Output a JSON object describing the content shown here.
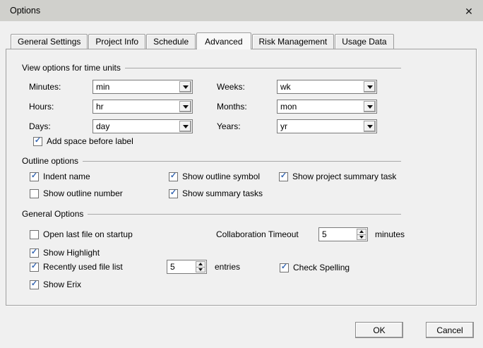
{
  "window": {
    "title": "Options"
  },
  "glyphs": {
    "check": "✓",
    "close": "✕"
  },
  "colors": {
    "titlebar": "#d0d0cc",
    "body": "#f0f0f0",
    "check_blue": "#3566b2",
    "group_line": "#a8a8a8"
  },
  "tabs": [
    {
      "label": "General Settings",
      "selected": false
    },
    {
      "label": "Project Info",
      "selected": false
    },
    {
      "label": "Schedule",
      "selected": false
    },
    {
      "label": "Advanced",
      "selected": true
    },
    {
      "label": "Risk Management",
      "selected": false
    },
    {
      "label": "Usage Data",
      "selected": false
    }
  ],
  "time_units": {
    "title": "View options for time units",
    "rows": [
      {
        "left_label": "Minutes:",
        "left_value": "min",
        "right_label": "Weeks:",
        "right_value": "wk"
      },
      {
        "left_label": "Hours:",
        "left_value": "hr",
        "right_label": "Months:",
        "right_value": "mon"
      },
      {
        "left_label": "Days:",
        "left_value": "day",
        "right_label": "Years:",
        "right_value": "yr"
      }
    ],
    "add_space": {
      "label": "Add space before label",
      "checked": true
    }
  },
  "outline": {
    "title": "Outline options",
    "items": [
      {
        "label": "Indent name",
        "checked": true
      },
      {
        "label": "Show outline number",
        "checked": false
      },
      {
        "label": "Show outline symbol",
        "checked": true
      },
      {
        "label": "Show summary tasks",
        "checked": true
      },
      {
        "label": "Show project summary task",
        "checked": true
      }
    ]
  },
  "general": {
    "title": "General Options",
    "open_last_file": {
      "label": "Open last file on startup",
      "checked": false
    },
    "show_highlight": {
      "label": "Show Highlight",
      "checked": true
    },
    "recently_used": {
      "label": "Recently used file list",
      "checked": true,
      "value": "5",
      "suffix": "entries"
    },
    "show_erix": {
      "label": "Show Erix",
      "checked": true
    },
    "check_spelling": {
      "label": "Check Spelling",
      "checked": true
    },
    "collaboration": {
      "label": "Collaboration Timeout",
      "value": "5",
      "suffix": "minutes"
    }
  },
  "buttons": {
    "ok": "OK",
    "cancel": "Cancel"
  }
}
